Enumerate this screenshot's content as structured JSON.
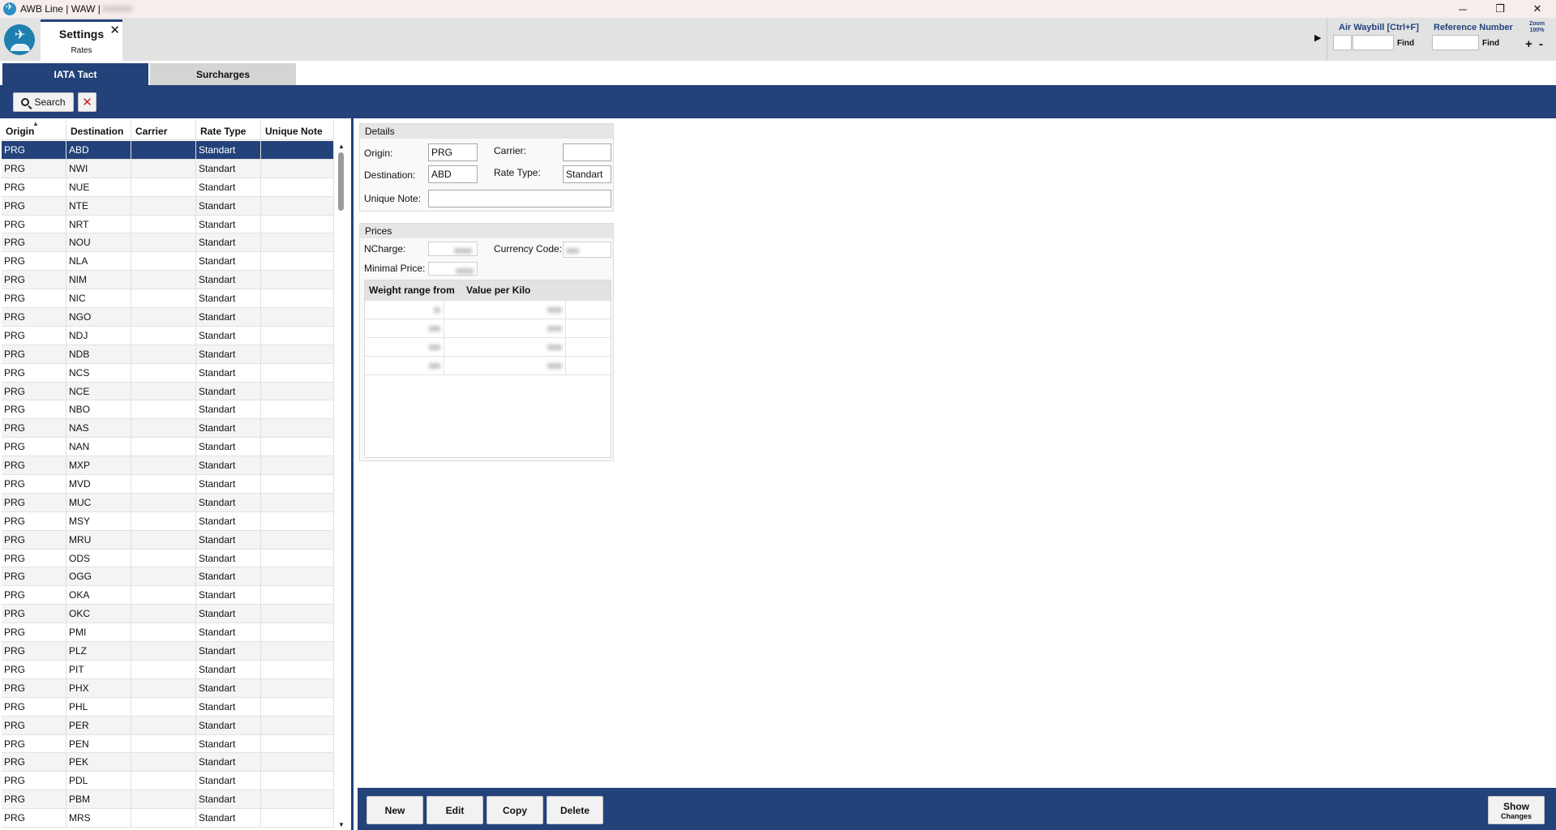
{
  "window": {
    "title": "AWB Line | WAW |",
    "minimize": "─",
    "restore": "❐",
    "close": "✕"
  },
  "doc_tab": {
    "title": "Settings",
    "subtitle": "Rates",
    "close": "✕"
  },
  "quick_search": {
    "expand_glyph": "▶",
    "awb_label": "Air Waybill [Ctrl+F]",
    "ref_label": "Reference Number",
    "find_label": "Find",
    "zoom_label": "Zoom",
    "zoom_value": "100%",
    "zoom_in": "+",
    "zoom_out": "-"
  },
  "module_tabs": [
    {
      "label": "IATA Tact",
      "active": true
    },
    {
      "label": "Surcharges",
      "active": false
    }
  ],
  "toolbar": {
    "search_label": "Search",
    "clear_glyph": "✕"
  },
  "table": {
    "columns": [
      "Origin",
      "Destination",
      "Carrier",
      "Rate Type",
      "Unique Note"
    ],
    "sort_glyph": "▲",
    "rows": [
      [
        "PRG",
        "ABD",
        "",
        "Standart",
        ""
      ],
      [
        "PRG",
        "NWI",
        "",
        "Standart",
        ""
      ],
      [
        "PRG",
        "NUE",
        "",
        "Standart",
        ""
      ],
      [
        "PRG",
        "NTE",
        "",
        "Standart",
        ""
      ],
      [
        "PRG",
        "NRT",
        "",
        "Standart",
        ""
      ],
      [
        "PRG",
        "NOU",
        "",
        "Standart",
        ""
      ],
      [
        "PRG",
        "NLA",
        "",
        "Standart",
        ""
      ],
      [
        "PRG",
        "NIM",
        "",
        "Standart",
        ""
      ],
      [
        "PRG",
        "NIC",
        "",
        "Standart",
        ""
      ],
      [
        "PRG",
        "NGO",
        "",
        "Standart",
        ""
      ],
      [
        "PRG",
        "NDJ",
        "",
        "Standart",
        ""
      ],
      [
        "PRG",
        "NDB",
        "",
        "Standart",
        ""
      ],
      [
        "PRG",
        "NCS",
        "",
        "Standart",
        ""
      ],
      [
        "PRG",
        "NCE",
        "",
        "Standart",
        ""
      ],
      [
        "PRG",
        "NBO",
        "",
        "Standart",
        ""
      ],
      [
        "PRG",
        "NAS",
        "",
        "Standart",
        ""
      ],
      [
        "PRG",
        "NAN",
        "",
        "Standart",
        ""
      ],
      [
        "PRG",
        "MXP",
        "",
        "Standart",
        ""
      ],
      [
        "PRG",
        "MVD",
        "",
        "Standart",
        ""
      ],
      [
        "PRG",
        "MUC",
        "",
        "Standart",
        ""
      ],
      [
        "PRG",
        "MSY",
        "",
        "Standart",
        ""
      ],
      [
        "PRG",
        "MRU",
        "",
        "Standart",
        ""
      ],
      [
        "PRG",
        "ODS",
        "",
        "Standart",
        ""
      ],
      [
        "PRG",
        "OGG",
        "",
        "Standart",
        ""
      ],
      [
        "PRG",
        "OKA",
        "",
        "Standart",
        ""
      ],
      [
        "PRG",
        "OKC",
        "",
        "Standart",
        ""
      ],
      [
        "PRG",
        "PMI",
        "",
        "Standart",
        ""
      ],
      [
        "PRG",
        "PLZ",
        "",
        "Standart",
        ""
      ],
      [
        "PRG",
        "PIT",
        "",
        "Standart",
        ""
      ],
      [
        "PRG",
        "PHX",
        "",
        "Standart",
        ""
      ],
      [
        "PRG",
        "PHL",
        "",
        "Standart",
        ""
      ],
      [
        "PRG",
        "PER",
        "",
        "Standart",
        ""
      ],
      [
        "PRG",
        "PEN",
        "",
        "Standart",
        ""
      ],
      [
        "PRG",
        "PEK",
        "",
        "Standart",
        ""
      ],
      [
        "PRG",
        "PDL",
        "",
        "Standart",
        ""
      ],
      [
        "PRG",
        "PBM",
        "",
        "Standart",
        ""
      ],
      [
        "PRG",
        "MRS",
        "",
        "Standart",
        ""
      ]
    ],
    "scroll_up": "▲",
    "scroll_down": "▼"
  },
  "details": {
    "heading": "Details",
    "origin_label": "Origin:",
    "origin_value": "PRG",
    "carrier_label": "Carrier:",
    "carrier_value": "",
    "destination_label": "Destination:",
    "destination_value": "ABD",
    "rate_type_label": "Rate Type:",
    "rate_type_value": "Standart",
    "unique_note_label": "Unique Note:",
    "unique_note_value": ""
  },
  "prices": {
    "heading": "Prices",
    "ncharge_label": "NCharge:",
    "currency_label": "Currency Code:",
    "minimal_label": "Minimal Price:",
    "columns": [
      "Weight range from",
      "Value per Kilo"
    ],
    "row_count": 4
  },
  "actions": {
    "new": "New",
    "edit": "Edit",
    "copy": "Copy",
    "delete": "Delete",
    "show_line1": "Show",
    "show_line2": "Changes"
  }
}
